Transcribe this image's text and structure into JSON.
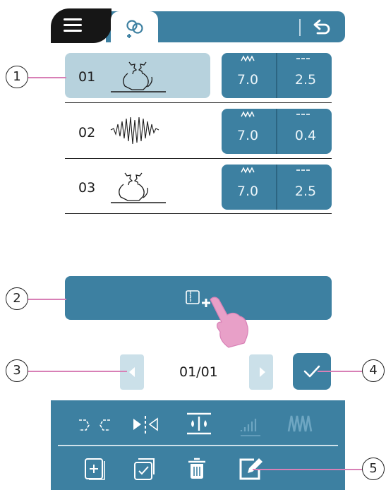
{
  "header": {
    "menu_icon": "menu-icon",
    "tab_icon": "link-pattern-icon",
    "back_icon": "back-arrow-icon"
  },
  "rows": [
    {
      "number": "01",
      "pattern": "cat",
      "width_value": "7.0",
      "length_value": "2.5",
      "selected": true
    },
    {
      "number": "02",
      "pattern": "heart-zigzag",
      "width_value": "7.0",
      "length_value": "0.4",
      "selected": false
    },
    {
      "number": "03",
      "pattern": "cat",
      "width_value": "7.0",
      "length_value": "2.5",
      "selected": false
    }
  ],
  "callouts": {
    "c1": "1",
    "c2": "2",
    "c3": "3",
    "c4": "4",
    "c5": "5"
  },
  "add_button": {
    "icon": "add-pattern-icon"
  },
  "pager": {
    "page": "01/01"
  },
  "toolbar": {
    "row1": [
      "mirror-horizontal-icon",
      "mirror-vertical-icon",
      "density-icon",
      "elongation-icon",
      "satin-icon"
    ],
    "row2": [
      "new-page-icon",
      "duplicate-icon",
      "delete-icon",
      "edit-icon"
    ]
  },
  "colors": {
    "accent": "#3d80a1",
    "highlight": "#b7d2dd",
    "callout_line": "#d880b6"
  }
}
